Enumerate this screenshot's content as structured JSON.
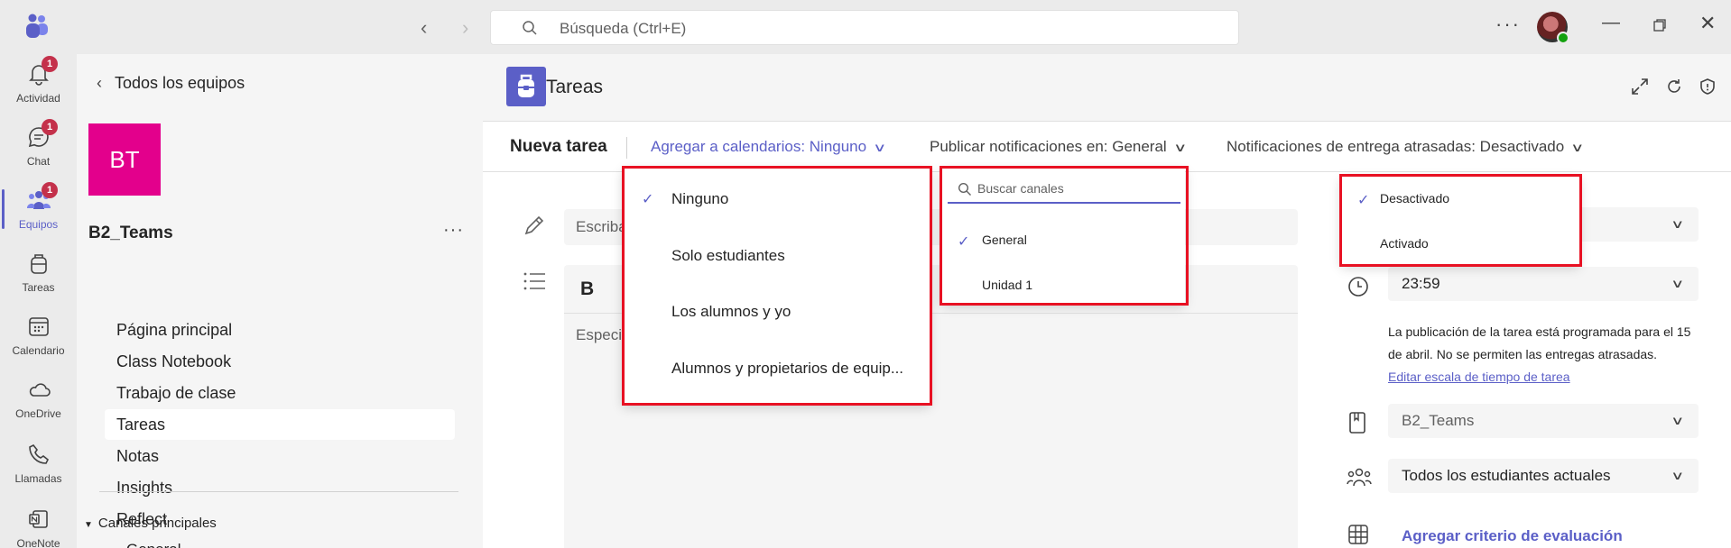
{
  "titlebar": {
    "search_placeholder": "Búsqueda (Ctrl+E)",
    "more_label": "···"
  },
  "rail": {
    "items": [
      {
        "label": "Actividad",
        "badge": "1"
      },
      {
        "label": "Chat",
        "badge": "1"
      },
      {
        "label": "Equipos",
        "badge": "1"
      },
      {
        "label": "Tareas"
      },
      {
        "label": "Calendario"
      },
      {
        "label": "OneDrive"
      },
      {
        "label": "Llamadas"
      },
      {
        "label": "OneNote"
      }
    ]
  },
  "team": {
    "back_label": "Todos los equipos",
    "tile_initials": "BT",
    "tile_color": "#e3008c",
    "name": "B2_Teams",
    "more_label": "···",
    "nav": [
      "Página principal",
      "Class Notebook",
      "Trabajo de clase",
      "Tareas",
      "Notas",
      "Insights",
      "Reflect"
    ],
    "selected_nav": "Tareas",
    "channels_label": "Canales principales",
    "channel_partial": "General"
  },
  "app": {
    "title": "Tareas",
    "accent": "#5b5fc7"
  },
  "toolbar": {
    "new_task": "Nueva tarea",
    "add_calendars": "Agregar a calendarios: Ninguno",
    "publish_notifications": "Publicar notificaciones en: General",
    "late_notifications": "Notificaciones de entrega atrasadas: Desactivado"
  },
  "form": {
    "title_placeholder": "Escriba el título de la tarea (obligatorio)",
    "bold_label": "B",
    "instructions_placeholder": "Especifique las instrucciones",
    "time_value": "23:59",
    "info_line": "La publicación de la tarea está programada para el 15 de abril. No se permiten las entregas atrasadas.",
    "edit_timeline": "Editar escala de tiempo de tarea",
    "class_value": "B2_Teams",
    "students_value": "Todos los estudiantes actuales",
    "rubric": "Agregar criterio de evaluación"
  },
  "calendar_menu": {
    "options": [
      "Ninguno",
      "Solo estudiantes",
      "Los alumnos y yo",
      "Alumnos y propietarios de equip..."
    ],
    "selected": "Ninguno"
  },
  "channel_menu": {
    "search_placeholder": "Buscar canales",
    "options": [
      "General",
      "Unidad 1"
    ],
    "selected": "General"
  },
  "late_menu": {
    "options": [
      "Desactivado",
      "Activado"
    ],
    "selected": "Desactivado"
  },
  "highlight_color": "#e81123"
}
